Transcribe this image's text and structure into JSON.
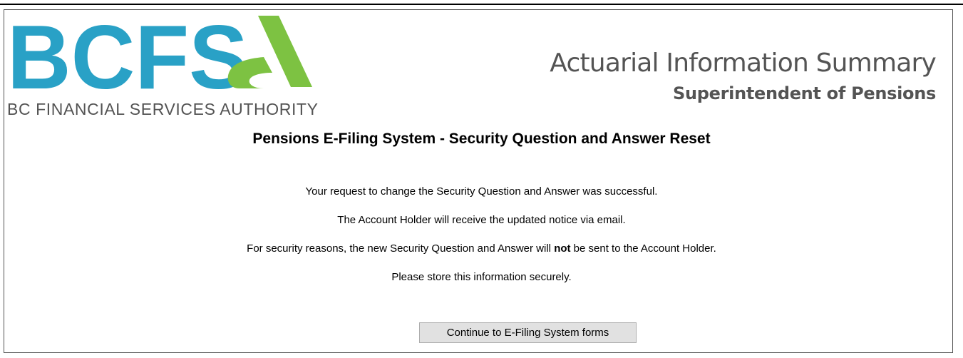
{
  "logo": {
    "letters": "BCFS",
    "glyph": "a",
    "subtitle": "BC FINANCIAL SERVICES AUTHORITY",
    "colors": {
      "blue": "#29a1c6",
      "green": "#7dc242"
    }
  },
  "header": {
    "title": "Actuarial Information Summary",
    "subtitle": "Superintendent of Pensions"
  },
  "page": {
    "title": "Pensions E-Filing System - Security Question and Answer Reset"
  },
  "messages": {
    "line1": "Your request to change the Security Question and Answer was successful.",
    "line2": "The Account Holder will receive the updated notice via email.",
    "line3_before": "For security reasons, the new Security Question and Answer will ",
    "line3_bold": "not",
    "line3_after": " be sent to the Account Holder.",
    "line4": "Please store this information securely."
  },
  "actions": {
    "continue_label": "Continue to E-Filing System forms"
  }
}
